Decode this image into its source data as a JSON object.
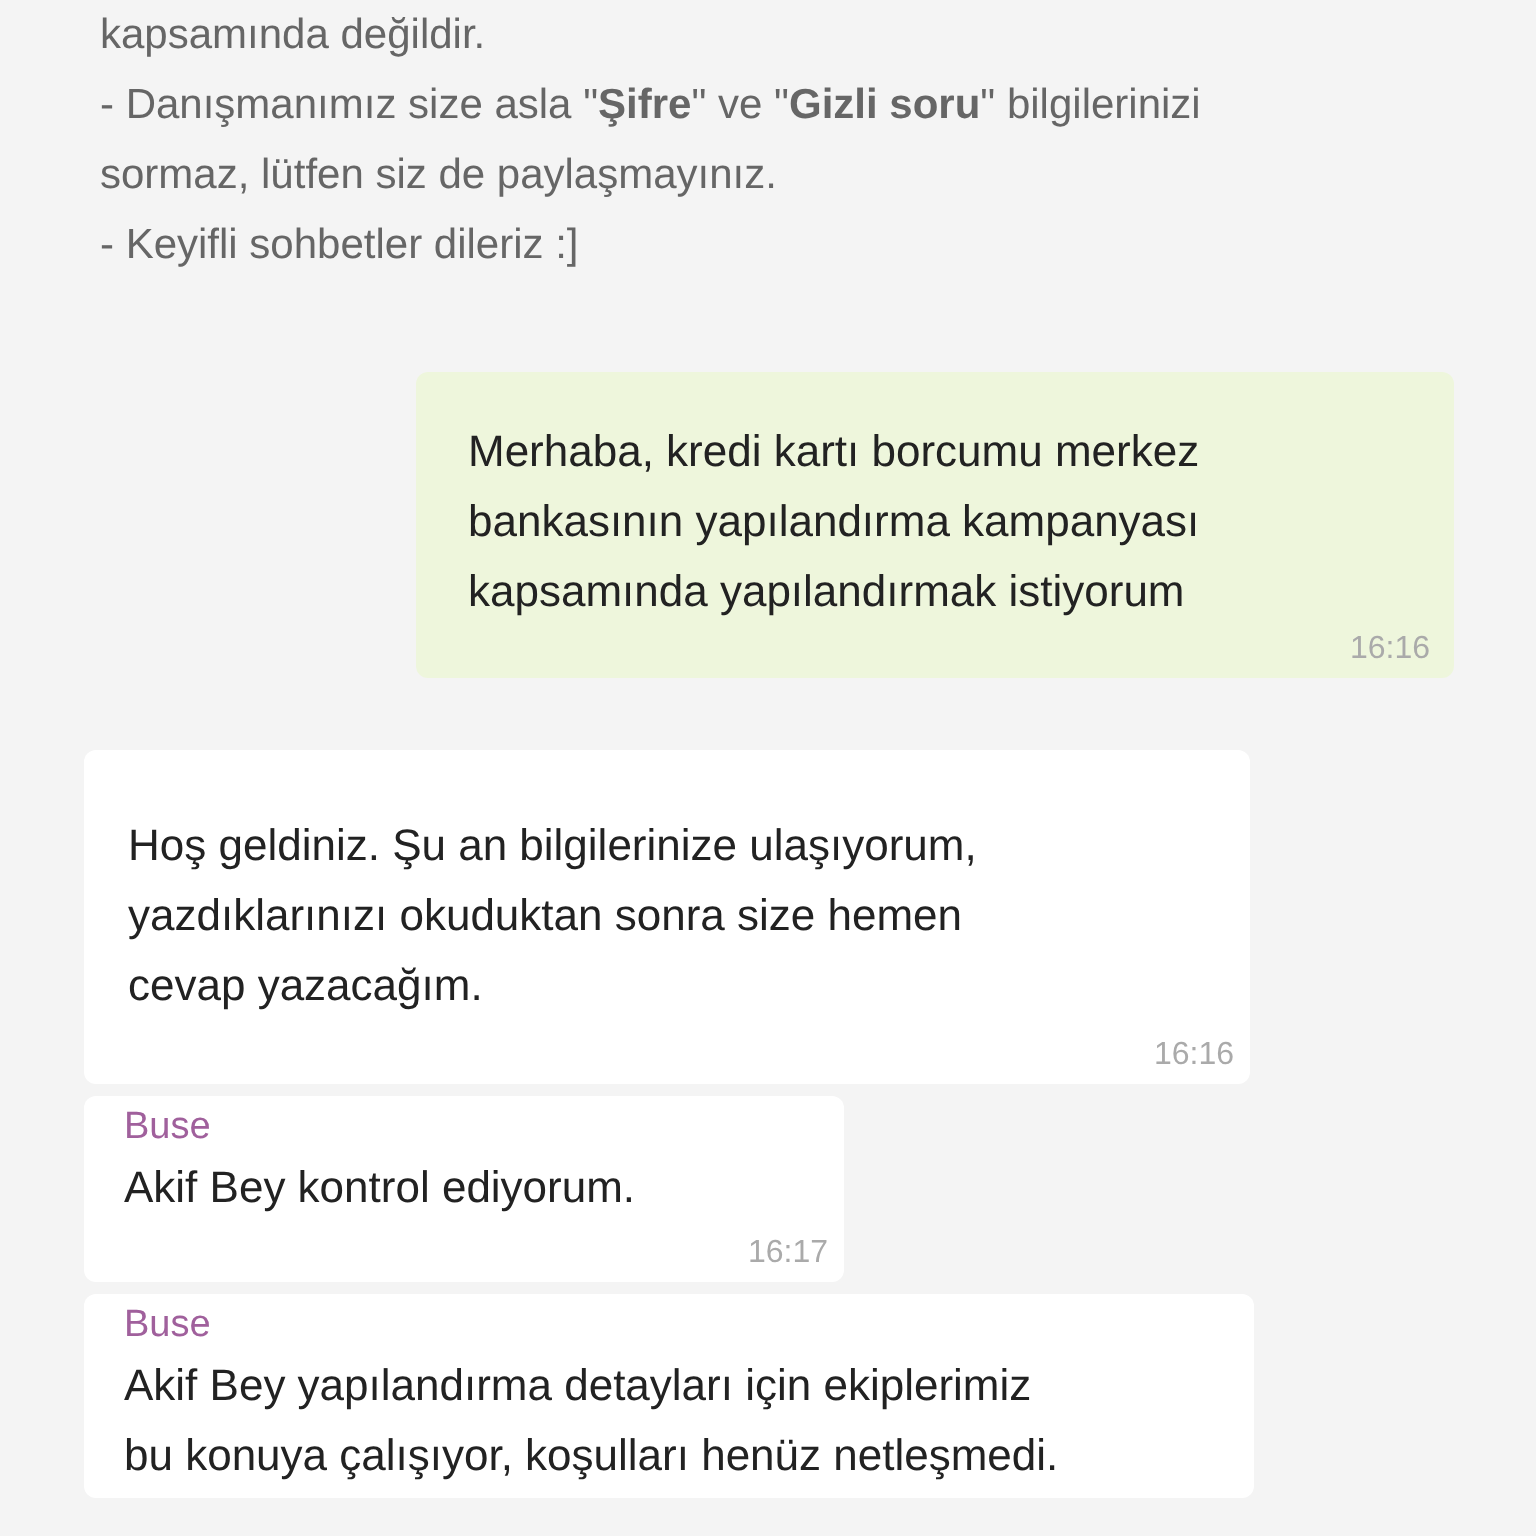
{
  "system_message": {
    "text": "kapsamında değildir.\n- Danışmanımız size asla \"**Şifre**\" ve \"**Gizli soru**\" bilgilerinizi\nsormaz, lütfen siz de paylaşmayınız.\n- Keyifli sohbetler dileriz :]"
  },
  "messages": [
    {
      "kind": "outgoing",
      "text": "Merhaba, kredi kartı borcumu merkez\nbankasının yapılandırma kampanyası\nkapsamında yapılandırmak istiyorum",
      "time": "16:16"
    },
    {
      "kind": "incoming",
      "text": "Hoş geldiniz. Şu an bilgilerinize ulaşıyorum,\nyazdıklarınızı okuduktan sonra size hemen\ncevap yazacağım.",
      "time": "16:16"
    },
    {
      "kind": "incoming",
      "sender": "Buse",
      "text": "Akif Bey kontrol ediyorum.",
      "time": "16:17"
    },
    {
      "kind": "incoming",
      "sender": "Buse",
      "text": "Akif Bey yapılandırma detayları için ekiplerimiz\nbu konuya çalışıyor, koşulları henüz netleşmedi."
    }
  ]
}
